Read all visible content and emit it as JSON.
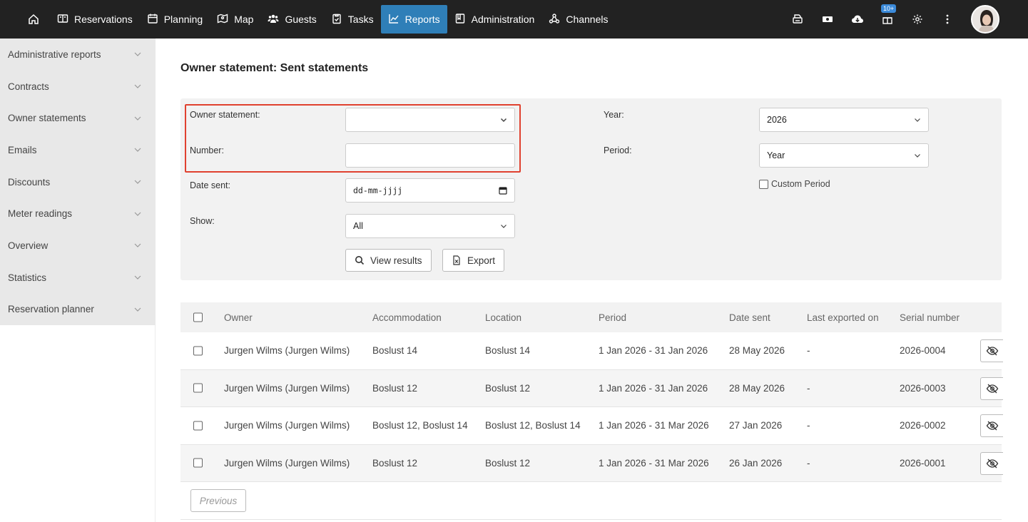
{
  "nav": {
    "items": [
      {
        "label": "Reservations",
        "icon": "book-icon"
      },
      {
        "label": "Planning",
        "icon": "calendar-icon"
      },
      {
        "label": "Map",
        "icon": "map-icon"
      },
      {
        "label": "Guests",
        "icon": "users-icon"
      },
      {
        "label": "Tasks",
        "icon": "clipboard-icon"
      },
      {
        "label": "Reports",
        "icon": "chart-icon",
        "active": true
      },
      {
        "label": "Administration",
        "icon": "ledger-icon"
      },
      {
        "label": "Channels",
        "icon": "network-icon"
      }
    ],
    "notification_badge": "10+",
    "active_color": "#2f7fb8"
  },
  "sidebar": {
    "items": [
      {
        "label": "Administrative reports"
      },
      {
        "label": "Contracts"
      },
      {
        "label": "Owner statements"
      },
      {
        "label": "Emails"
      },
      {
        "label": "Discounts"
      },
      {
        "label": "Meter readings"
      },
      {
        "label": "Overview"
      },
      {
        "label": "Statistics"
      },
      {
        "label": "Reservation planner"
      }
    ]
  },
  "page": {
    "title": "Owner statement: Sent statements"
  },
  "filters": {
    "owner_statement_label": "Owner statement:",
    "owner_statement_value": "",
    "number_label": "Number:",
    "number_value": "",
    "date_sent_label": "Date sent:",
    "date_sent_value": "dd-mm-jjjj",
    "show_label": "Show:",
    "show_value": "All",
    "year_label": "Year:",
    "year_value": "2026",
    "period_label": "Period:",
    "period_value": "Year",
    "custom_period_label": "Custom Period",
    "view_results_label": "View results",
    "export_label": "Export",
    "highlight_color": "#e0412f"
  },
  "table": {
    "headers": {
      "owner": "Owner",
      "accommodation": "Accommodation",
      "location": "Location",
      "period": "Period",
      "date_sent": "Date sent",
      "last_exported": "Last exported on",
      "serial": "Serial number"
    },
    "rows": [
      {
        "owner": "Jurgen Wilms (Jurgen Wilms)",
        "accommodation": "Boslust 14",
        "location": "Boslust 14",
        "period": "1 Jan 2026 - 31 Jan 2026",
        "date_sent": "28 May 2026",
        "last_exported": "-",
        "serial": "2026-0004"
      },
      {
        "owner": "Jurgen Wilms (Jurgen Wilms)",
        "accommodation": "Boslust 12",
        "location": "Boslust 12",
        "period": "1 Jan 2026 - 31 Jan 2026",
        "date_sent": "28 May 2026",
        "last_exported": "-",
        "serial": "2026-0003"
      },
      {
        "owner": "Jurgen Wilms (Jurgen Wilms)",
        "accommodation": "Boslust 12, Boslust 14",
        "location": "Boslust 12, Boslust 14",
        "period": "1 Jan 2026 - 31 Mar 2026",
        "date_sent": "27 Jan 2026",
        "last_exported": "-",
        "serial": "2026-0002"
      },
      {
        "owner": "Jurgen Wilms (Jurgen Wilms)",
        "accommodation": "Boslust 12",
        "location": "Boslust 12",
        "period": "1 Jan 2026 - 31 Mar 2026",
        "date_sent": "26 Jan 2026",
        "last_exported": "-",
        "serial": "2026-0001"
      }
    ],
    "previous_label": "Previous"
  }
}
